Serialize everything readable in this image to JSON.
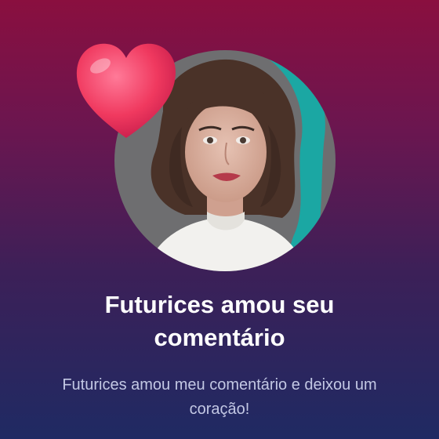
{
  "notification": {
    "title": "Futurices amou seu comentário",
    "message": "Futurices amou meu comentário e deixou um coração!",
    "avatar_icon": "profile-photo",
    "reaction_icon": "heart-icon"
  },
  "colors": {
    "background_top": "#8a0f3f",
    "background_bottom": "#1f2a63",
    "heart": "#f0395f",
    "avatar_accent": "#1ba7a3",
    "subtitle": "#c3c8e4"
  }
}
